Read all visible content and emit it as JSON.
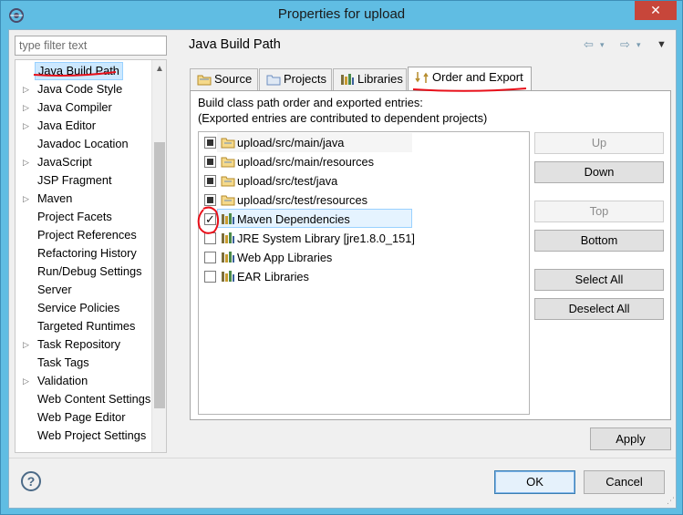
{
  "window": {
    "title": "Properties for upload",
    "close_label": "✕"
  },
  "filter": {
    "placeholder": "type filter text"
  },
  "tree": {
    "items": [
      {
        "label": "Java Build Path",
        "expandable": false,
        "selected": true
      },
      {
        "label": "Java Code Style",
        "expandable": true
      },
      {
        "label": "Java Compiler",
        "expandable": true
      },
      {
        "label": "Java Editor",
        "expandable": true
      },
      {
        "label": "Javadoc Location",
        "expandable": false
      },
      {
        "label": "JavaScript",
        "expandable": true
      },
      {
        "label": "JSP Fragment",
        "expandable": false
      },
      {
        "label": "Maven",
        "expandable": true
      },
      {
        "label": "Project Facets",
        "expandable": false
      },
      {
        "label": "Project References",
        "expandable": false
      },
      {
        "label": "Refactoring History",
        "expandable": false
      },
      {
        "label": "Run/Debug Settings",
        "expandable": false
      },
      {
        "label": "Server",
        "expandable": false
      },
      {
        "label": "Service Policies",
        "expandable": false
      },
      {
        "label": "Targeted Runtimes",
        "expandable": false
      },
      {
        "label": "Task Repository",
        "expandable": true
      },
      {
        "label": "Task Tags",
        "expandable": false
      },
      {
        "label": "Validation",
        "expandable": true
      },
      {
        "label": "Web Content Settings",
        "expandable": false
      },
      {
        "label": "Web Page Editor",
        "expandable": false
      },
      {
        "label": "Web Project Settings",
        "expandable": false
      }
    ]
  },
  "page": {
    "title": "Java Build Path"
  },
  "tabs": [
    {
      "label": "Source",
      "icon": "source-folder-icon",
      "active": false
    },
    {
      "label": "Projects",
      "icon": "projects-icon",
      "active": false
    },
    {
      "label": "Libraries",
      "icon": "libraries-icon",
      "active": false
    },
    {
      "label": "Order and Export",
      "icon": "order-export-icon",
      "active": true
    }
  ],
  "panel": {
    "desc_line1": "Build class path order and exported entries:",
    "desc_line2": "(Exported entries are contributed to dependent projects)"
  },
  "entries": [
    {
      "label": "upload/src/main/java",
      "state": "partial",
      "icon": "source-folder-icon"
    },
    {
      "label": "upload/src/main/resources",
      "state": "partial",
      "icon": "source-folder-icon"
    },
    {
      "label": "upload/src/test/java",
      "state": "partial",
      "icon": "source-folder-icon"
    },
    {
      "label": "upload/src/test/resources",
      "state": "partial",
      "icon": "source-folder-icon"
    },
    {
      "label": "Maven Dependencies",
      "state": "checked",
      "icon": "library-icon",
      "selected": true
    },
    {
      "label": "JRE System Library [jre1.8.0_151]",
      "state": "unchecked",
      "icon": "library-icon"
    },
    {
      "label": "Web App Libraries",
      "state": "unchecked",
      "icon": "library-icon"
    },
    {
      "label": "EAR Libraries",
      "state": "unchecked",
      "icon": "library-icon"
    }
  ],
  "buttons": {
    "up": "Up",
    "down": "Down",
    "top": "Top",
    "bottom": "Bottom",
    "select_all": "Select All",
    "deselect_all": "Deselect All",
    "apply": "Apply",
    "ok": "OK",
    "cancel": "Cancel",
    "help": "?"
  },
  "colors": {
    "annotation": "#e8101a",
    "selection": "#cce8ff",
    "titlebar": "#60bde3"
  }
}
